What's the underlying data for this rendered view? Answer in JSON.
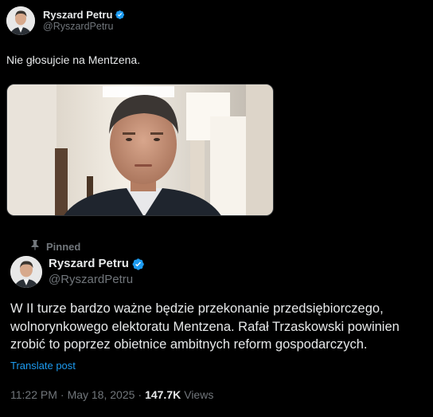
{
  "top_tweet": {
    "author_name": "Ryszard Petru",
    "author_handle": "@RyszardPetru",
    "text": "Nie głosujcie na Mentzena."
  },
  "pinned": {
    "label": "Pinned"
  },
  "main_tweet": {
    "author_name": "Ryszard Petru",
    "author_handle": "@RyszardPetru",
    "text": "W II turze bardzo ważne będzie przekonanie przedsiębiorczego, wolnorynkowego elektoratu Mentzena. Rafał Trzaskowski powinien zrobić to poprzez obietnice ambitnych reform gospodarczych.",
    "translate_label": "Translate post",
    "time": "11:22 PM",
    "date": "May 18, 2025",
    "separator": "·",
    "views_count": "147.7K",
    "views_label": "Views"
  },
  "colors": {
    "background": "#000000",
    "text_primary": "#e7e9ea",
    "text_secondary": "#71767b",
    "link": "#1d9bf0",
    "verified_badge": "#1d9bf0"
  },
  "icons": {
    "verified": "verified-badge-icon",
    "pin": "pin-icon"
  }
}
